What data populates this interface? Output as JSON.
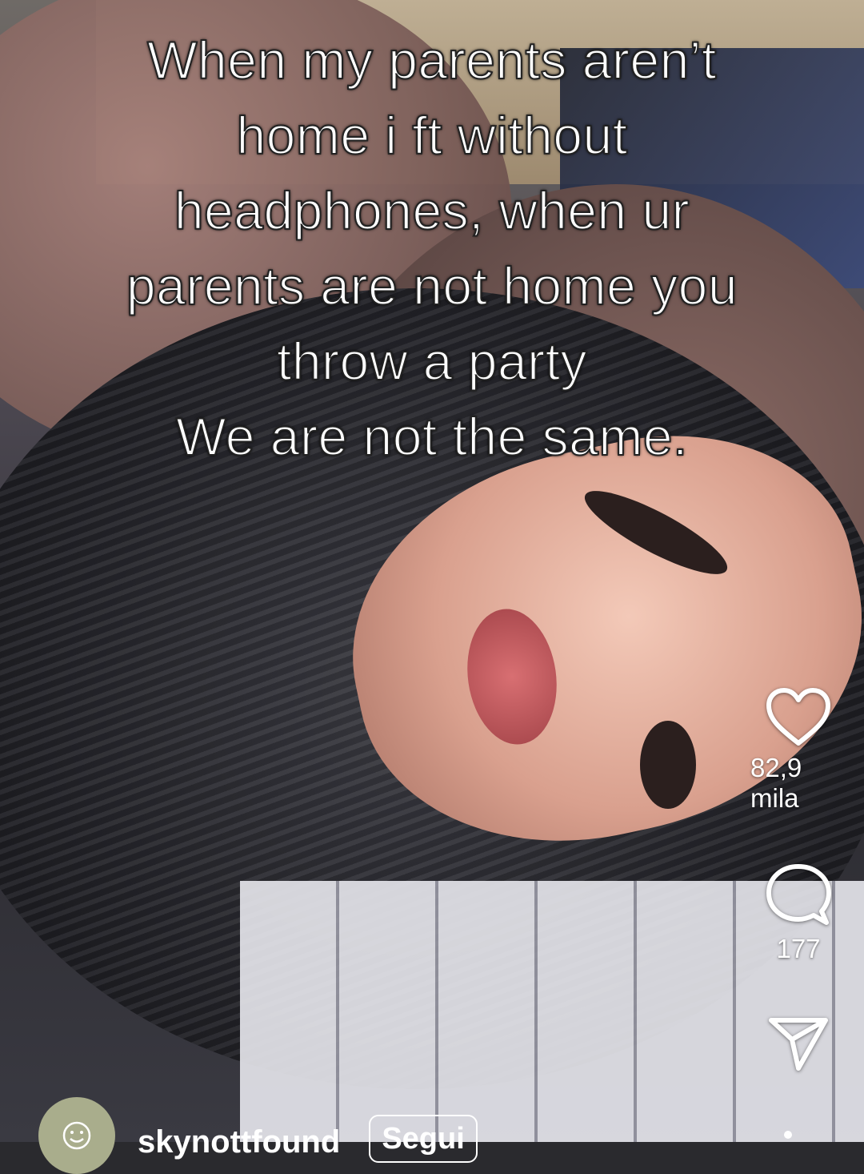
{
  "caption": {
    "lines": [
      "When my parents aren’t",
      "home i ft without",
      "headphones, when ur",
      "parents are not home you",
      "throw a party",
      "We are not the same."
    ]
  },
  "actions": {
    "like_count": "82,9 mila",
    "comment_count": "177"
  },
  "author": {
    "username": "skynottfound",
    "follow_label": "Segui"
  }
}
